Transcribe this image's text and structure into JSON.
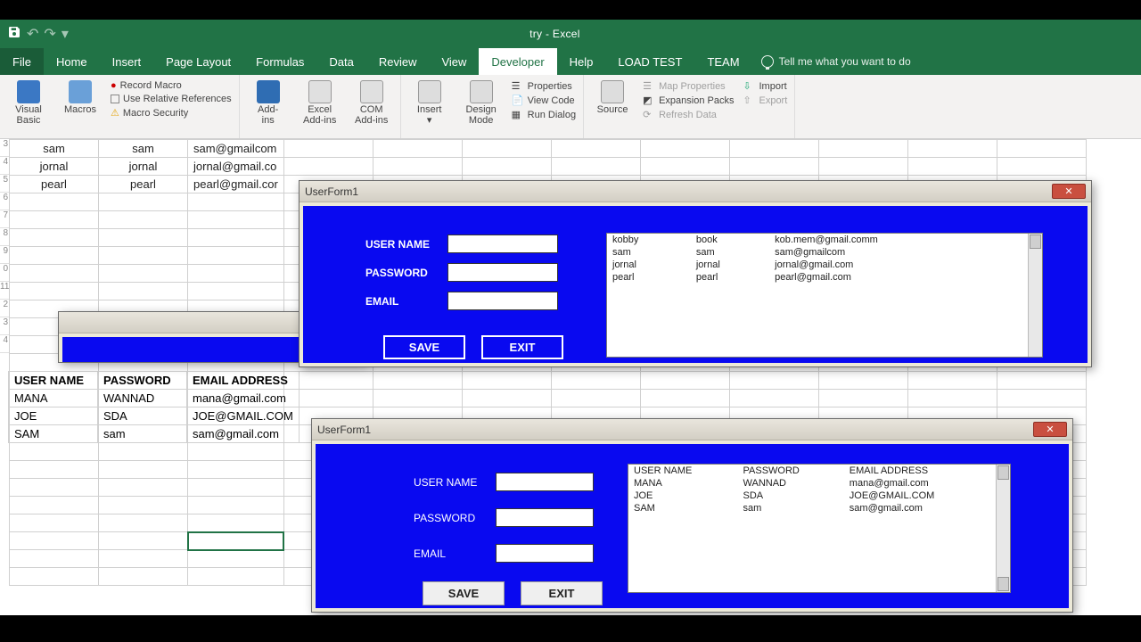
{
  "title": "try  -  Excel",
  "tabs": [
    "File",
    "Home",
    "Insert",
    "Page Layout",
    "Formulas",
    "Data",
    "Review",
    "View",
    "Developer",
    "Help",
    "LOAD TEST",
    "TEAM"
  ],
  "active_tab": "Developer",
  "tellme": "Tell me what you want to do",
  "ribbon": {
    "code": {
      "vb": "Visual\nBasic",
      "macros": "Macros",
      "rec": "Record Macro",
      "rel": "Use Relative References",
      "sec": "Macro Security"
    },
    "addins": {
      "a": "Add-\nins",
      "b": "Excel\nAdd-ins",
      "c": "COM\nAdd-ins"
    },
    "controls": {
      "insert": "Insert",
      "design": "Design\nMode",
      "props": "Properties",
      "code": "View Code",
      "dlg": "Run Dialog"
    },
    "xml": {
      "src": "Source",
      "mp": "Map Properties",
      "ep": "Expansion Packs",
      "rd": "Refresh Data",
      "imp": "Import",
      "exp": "Export"
    }
  },
  "sheet_top": [
    {
      "rn": "3",
      "a": "sam",
      "b": "sam",
      "c": "sam@gmailcom"
    },
    {
      "rn": "4",
      "a": "jornal",
      "b": "jornal",
      "c": "jornal@gmail.co"
    },
    {
      "rn": "5",
      "a": "pearl",
      "b": "pearl",
      "c": "pearl@gmail.cor"
    }
  ],
  "row_numbers_extra": [
    "6",
    "7",
    "8",
    "9",
    "0",
    "11",
    "2",
    "3",
    "4"
  ],
  "sheet_lower": {
    "headers": [
      "USER NAME",
      "PASSWORD",
      "EMAIL ADDRESS"
    ],
    "rows": [
      [
        "MANA",
        "WANNAD",
        "mana@gmail.com"
      ],
      [
        "JOE",
        "SDA",
        "JOE@GMAIL.COM"
      ],
      [
        "SAM",
        "sam",
        "sam@gmail.com"
      ]
    ]
  },
  "form1": {
    "title": "UserForm1",
    "labels": {
      "u": "USER NAME",
      "p": "PASSWORD",
      "e": "EMAIL"
    },
    "buttons": {
      "save": "SAVE",
      "exit": "EXIT"
    },
    "list": [
      [
        "kobby",
        "book",
        "kob.mem@gmail.comm"
      ],
      [
        "sam",
        "sam",
        "sam@gmailcom"
      ],
      [
        "jornal",
        "jornal",
        "jornal@gmail.com"
      ],
      [
        "pearl",
        "pearl",
        "pearl@gmail.com"
      ]
    ]
  },
  "form2": {
    "title": "UserForm1",
    "labels": {
      "u": "USER NAME",
      "p": "PASSWORD",
      "e": "EMAIL"
    },
    "buttons": {
      "save": "SAVE",
      "exit": "EXIT"
    },
    "list_headers": [
      "USER NAME",
      "PASSWORD",
      "EMAIL ADDRESS"
    ],
    "list": [
      [
        "MANA",
        "WANNAD",
        "mana@gmail.com"
      ],
      [
        "JOE",
        "SDA",
        "JOE@GMAIL.COM"
      ],
      [
        "SAM",
        "sam",
        "sam@gmail.com"
      ]
    ]
  }
}
